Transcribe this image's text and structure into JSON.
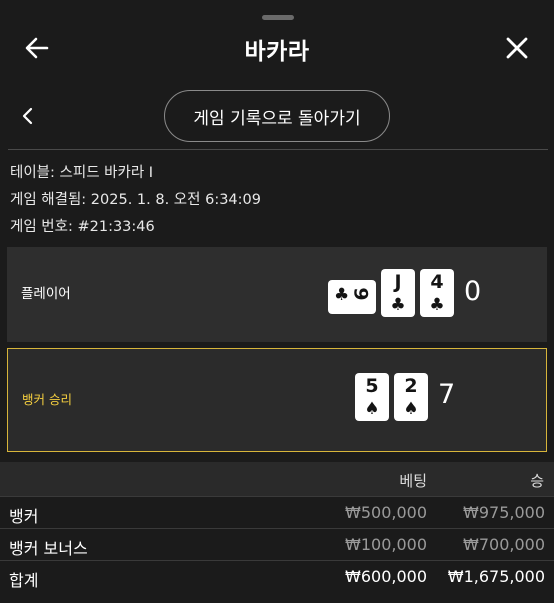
{
  "header": {
    "title": "바카라"
  },
  "nav": {
    "back_to_history_label": "게임 기록으로 돌아가기"
  },
  "info": {
    "table": "테이블: 스피드 바카라 I",
    "resolved": "게임 해결됨: 2025. 1. 8. 오전 6:34:09",
    "game_number": "게임 번호: #21:33:46"
  },
  "player_hand": {
    "label": "플레이어",
    "cards": [
      {
        "rank": "9",
        "suit": "♣",
        "orientation": "sideways"
      },
      {
        "rank": "J",
        "suit": "♣"
      },
      {
        "rank": "4",
        "suit": "♣"
      }
    ],
    "total": "0"
  },
  "banker_hand": {
    "label": "뱅커 승리",
    "cards": [
      {
        "rank": "5",
        "suit": "♠"
      },
      {
        "rank": "2",
        "suit": "♠"
      }
    ],
    "total": "7"
  },
  "bets": {
    "columns": {
      "bet": "베팅",
      "win": "승"
    },
    "rows": [
      {
        "name": "뱅커",
        "bet": "₩500,000",
        "win": "₩975,000"
      },
      {
        "name": "뱅커 보너스",
        "bet": "₩100,000",
        "win": "₩700,000"
      }
    ],
    "total": {
      "name": "합계",
      "bet": "₩600,000",
      "win": "₩1,675,000"
    }
  },
  "colors": {
    "background": "#1b1b1b",
    "panel": "#2e2e2e",
    "winner_accent": "#f4ce3f",
    "muted_value": "#9a9a9a"
  },
  "icons": {
    "back": "arrow-left-icon",
    "close": "close-icon",
    "nav_back": "chevron-left-icon"
  }
}
